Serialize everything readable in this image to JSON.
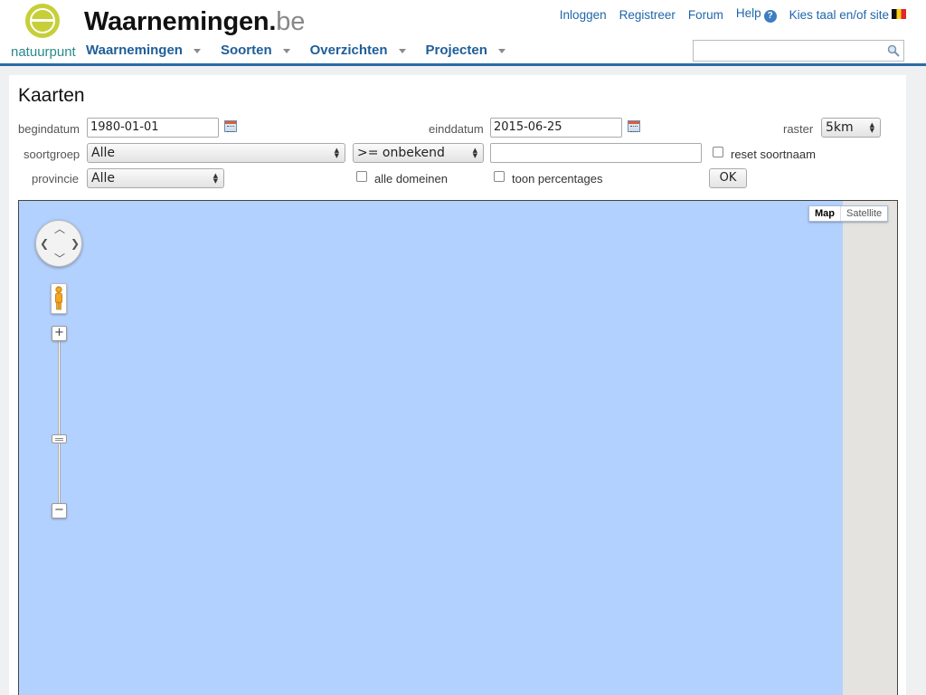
{
  "brand": {
    "logo_text": "natuurpunt",
    "site_name": "Waarnemingen.",
    "site_tld": "be"
  },
  "toplinks": {
    "login": "Inloggen",
    "register": "Registreer",
    "forum": "Forum",
    "help": "Help",
    "language": "Kies taal en/of site"
  },
  "nav": [
    "Waarnemingen",
    "Soorten",
    "Overzichten",
    "Projecten"
  ],
  "search": {
    "value": ""
  },
  "page": {
    "title": "Kaarten"
  },
  "form": {
    "begindatum": {
      "label": "begindatum",
      "value": "1980-01-01"
    },
    "einddatum": {
      "label": "einddatum",
      "value": "2015-06-25"
    },
    "raster": {
      "label": "raster",
      "value": "5km"
    },
    "soortgroep": {
      "label": "soortgroep",
      "value": "Alle"
    },
    "zekerheid": {
      "value": ">= onbekend"
    },
    "soortnaam": {
      "value": ""
    },
    "reset_soortnaam": {
      "label": "reset soortnaam"
    },
    "provincie": {
      "label": "provincie",
      "value": "Alle"
    },
    "alle_domeinen": {
      "label": "alle domeinen"
    },
    "toon_percentages": {
      "label": "toon percentages"
    },
    "ok": "OK"
  },
  "map": {
    "type_map": "Map",
    "type_satellite": "Satellite",
    "zoom_in": "+",
    "zoom_out": "−"
  },
  "colors": {
    "brand_blue": "#2c6ba3",
    "link": "#2266aa",
    "water": "#b3d1ff",
    "logo_green": "#c6cf38"
  }
}
